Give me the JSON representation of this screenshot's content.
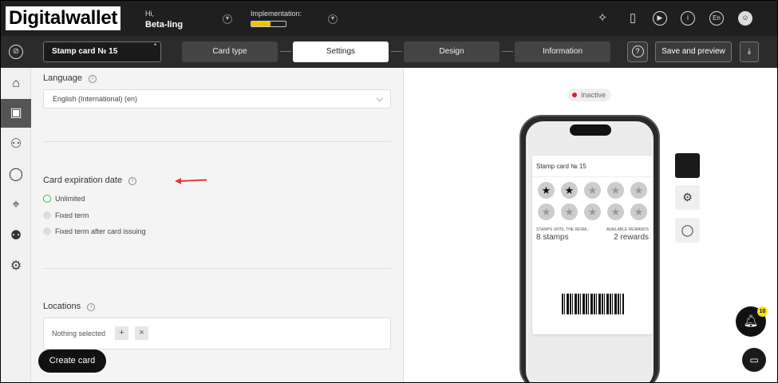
{
  "header": {
    "logo": "Digitalwallet",
    "greeting": "Hi,",
    "user_name": "Beta-ling",
    "implementation_label": "Implementation:",
    "implementation_progress": 0.55,
    "lang_badge": "En"
  },
  "navbar": {
    "card_name": "Stamp card № 15",
    "required_mark": "*",
    "steps": [
      "Card type",
      "Settings",
      "Design",
      "Information"
    ],
    "active_step": "Settings",
    "help_label": "?",
    "save_label": "Save and preview"
  },
  "settings": {
    "language_label": "Language",
    "language_value": "English (International) (en)",
    "expiration_label": "Card expiration date",
    "expiration_options": [
      "Unlimited",
      "Fixed term",
      "Fixed term after card issuing"
    ],
    "expiration_selected": "Unlimited",
    "locations_label": "Locations",
    "locations_value": "Nothing selected",
    "add_label": "+",
    "remove_label": "×",
    "create_card_label": "Create card"
  },
  "preview": {
    "status": "Inactive",
    "status_color": "#e0192e",
    "card_title": "Stamp card № 15",
    "stamps_total": 10,
    "stamps_filled": 2,
    "stamps_label": "STAMPS UNTIL THE REWA...",
    "stamps_value": "8 stamps",
    "rewards_label": "AVAILABLE REWARDS",
    "rewards_value": "2 rewards",
    "notification_count": "10",
    "platforms": [
      "apple-icon",
      "android-icon",
      "chat-bubble-icon"
    ]
  },
  "accent_color": "#f2c200",
  "sidebar_icons": [
    "home-icon",
    "card-icon",
    "users-icon",
    "messages-icon",
    "location-icon",
    "manager-icon",
    "settings-gear-icon"
  ]
}
